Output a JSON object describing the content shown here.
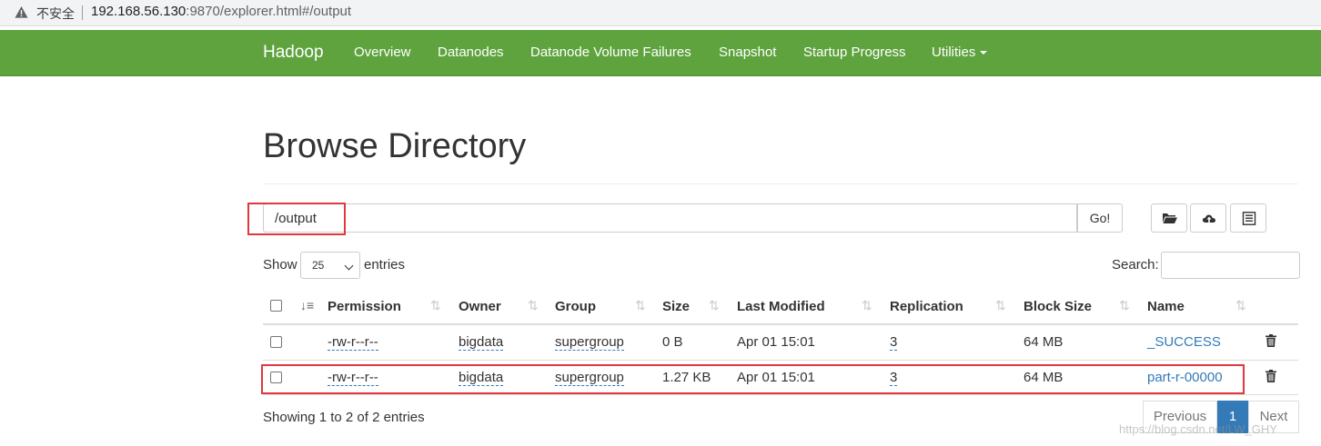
{
  "browser": {
    "security_label": "不安全",
    "url_host": "192.168.56.130",
    "url_rest": ":9870/explorer.html#/output"
  },
  "navbar": {
    "brand": "Hadoop",
    "links": [
      "Overview",
      "Datanodes",
      "Datanode Volume Failures",
      "Snapshot",
      "Startup Progress",
      "Utilities"
    ],
    "color": "#5fa33e"
  },
  "page": {
    "title": "Browse Directory",
    "directory_value": "/output",
    "go_label": "Go!"
  },
  "toolbar_icons": [
    "folder-open-icon",
    "cloud-upload-icon",
    "list-alt-icon"
  ],
  "table_controls": {
    "show_label": "Show",
    "length_value": "25",
    "entries_label": "entries",
    "search_label": "Search:"
  },
  "table": {
    "columns": [
      "Permission",
      "Owner",
      "Group",
      "Size",
      "Last Modified",
      "Replication",
      "Block Size",
      "Name"
    ],
    "rows": [
      {
        "permission": "-rw-r--r--",
        "owner": "bigdata",
        "group": "supergroup",
        "size": "0 B",
        "modified": "Apr 01 15:01",
        "replication": "3",
        "block_size": "64 MB",
        "name": "_SUCCESS"
      },
      {
        "permission": "-rw-r--r--",
        "owner": "bigdata",
        "group": "supergroup",
        "size": "1.27 KB",
        "modified": "Apr 01 15:01",
        "replication": "3",
        "block_size": "64 MB",
        "name": "part-r-00000"
      }
    ]
  },
  "footer": {
    "info": "Showing 1 to 2 of 2 entries",
    "previous": "Previous",
    "current_page": "1",
    "next": "Next",
    "watermark": "https://blog.csdn.net/LW_GHY"
  },
  "highlight_color": "#e0383e"
}
